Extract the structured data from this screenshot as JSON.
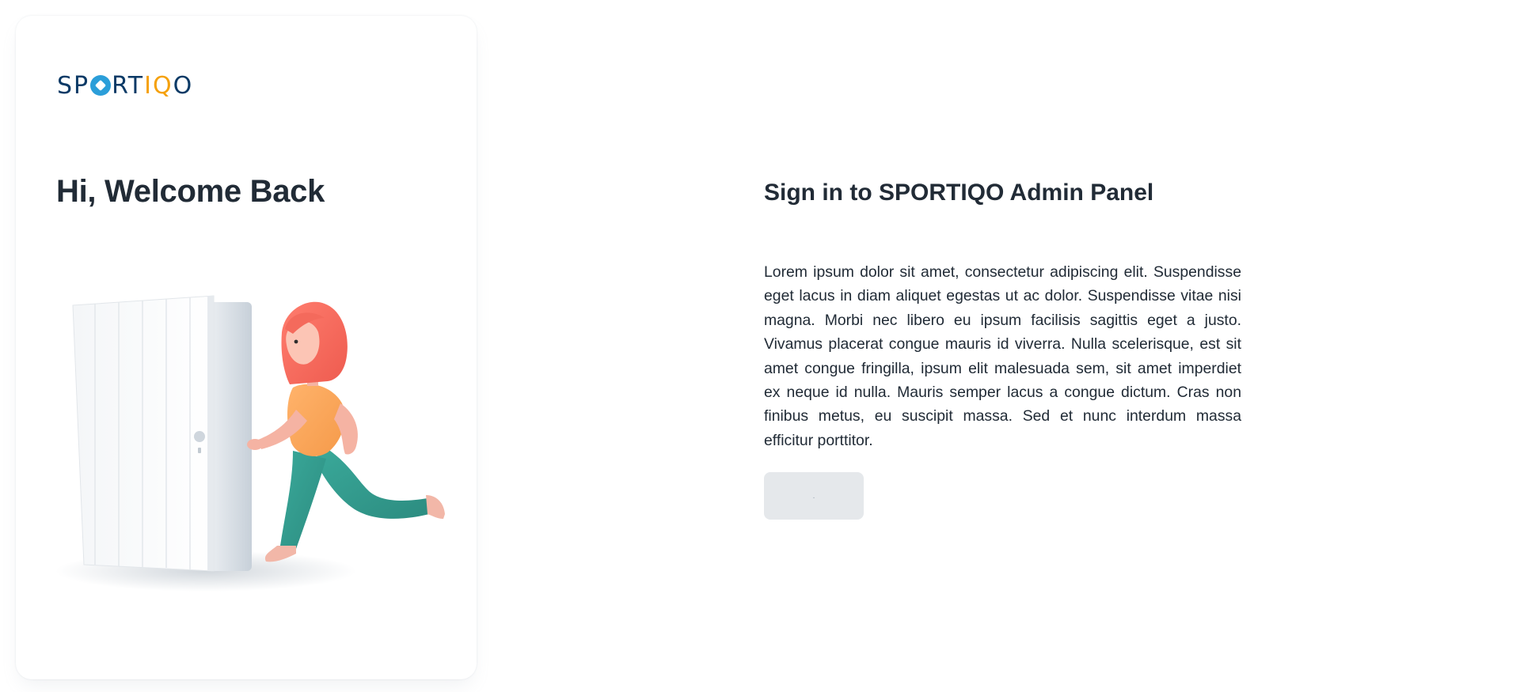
{
  "brand": {
    "logo_parts": [
      "SP",
      "RT",
      "IQ",
      "O"
    ],
    "logo_alt": "SPORTIQO",
    "colors": {
      "dark": "#0b3a66",
      "orange": "#f5a10b",
      "blue": "#2b9ed9"
    }
  },
  "left": {
    "welcome_title": "Hi, Welcome Back",
    "illustration": "woman-running-out-of-door"
  },
  "right": {
    "title": "Sign in to SPORTIQO Admin Panel",
    "description": "Lorem ipsum dolor sit amet, consectetur adipiscing elit. Suspendisse eget lacus in diam aliquet egestas ut ac dolor. Suspendisse vitae nisi magna. Morbi nec libero eu ipsum facilisis sagittis eget a justo. Vivamus placerat congue mauris id viverra. Nulla scelerisque, est sit amet congue fringilla, ipsum elit malesuada sem, sit amet imperdiet ex neque id nulla. Mauris semper lacus a congue dictum. Cras non finibus metus, eu suscipit massa. Sed et nunc interdum massa efficitur porttitor.",
    "button_label": "."
  }
}
